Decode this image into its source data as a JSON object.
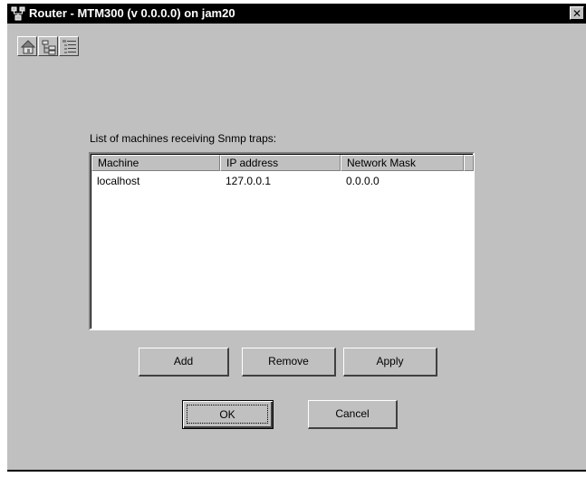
{
  "window": {
    "title": "Router - MTM300 (v 0.0.0.0) on jam20",
    "close_label": "✕"
  },
  "toolbar": {
    "buttons": [
      {
        "icon": "home-icon"
      },
      {
        "icon": "folder-tree-icon"
      },
      {
        "icon": "list-view-icon"
      }
    ]
  },
  "main": {
    "caption": "List of machines receiving Snmp traps:",
    "table": {
      "columns": [
        "Machine",
        "IP address",
        "Network Mask"
      ],
      "rows": [
        {
          "machine": "localhost",
          "ip": "127.0.0.1",
          "mask": "0.0.0.0"
        }
      ]
    },
    "actions": {
      "add": "Add",
      "remove": "Remove",
      "apply": "Apply"
    },
    "dialog": {
      "ok": "OK",
      "cancel": "Cancel"
    }
  },
  "colors": {
    "face": "#c0c0c0",
    "titlebar": "#000000",
    "list_bg": "#ffffff"
  }
}
